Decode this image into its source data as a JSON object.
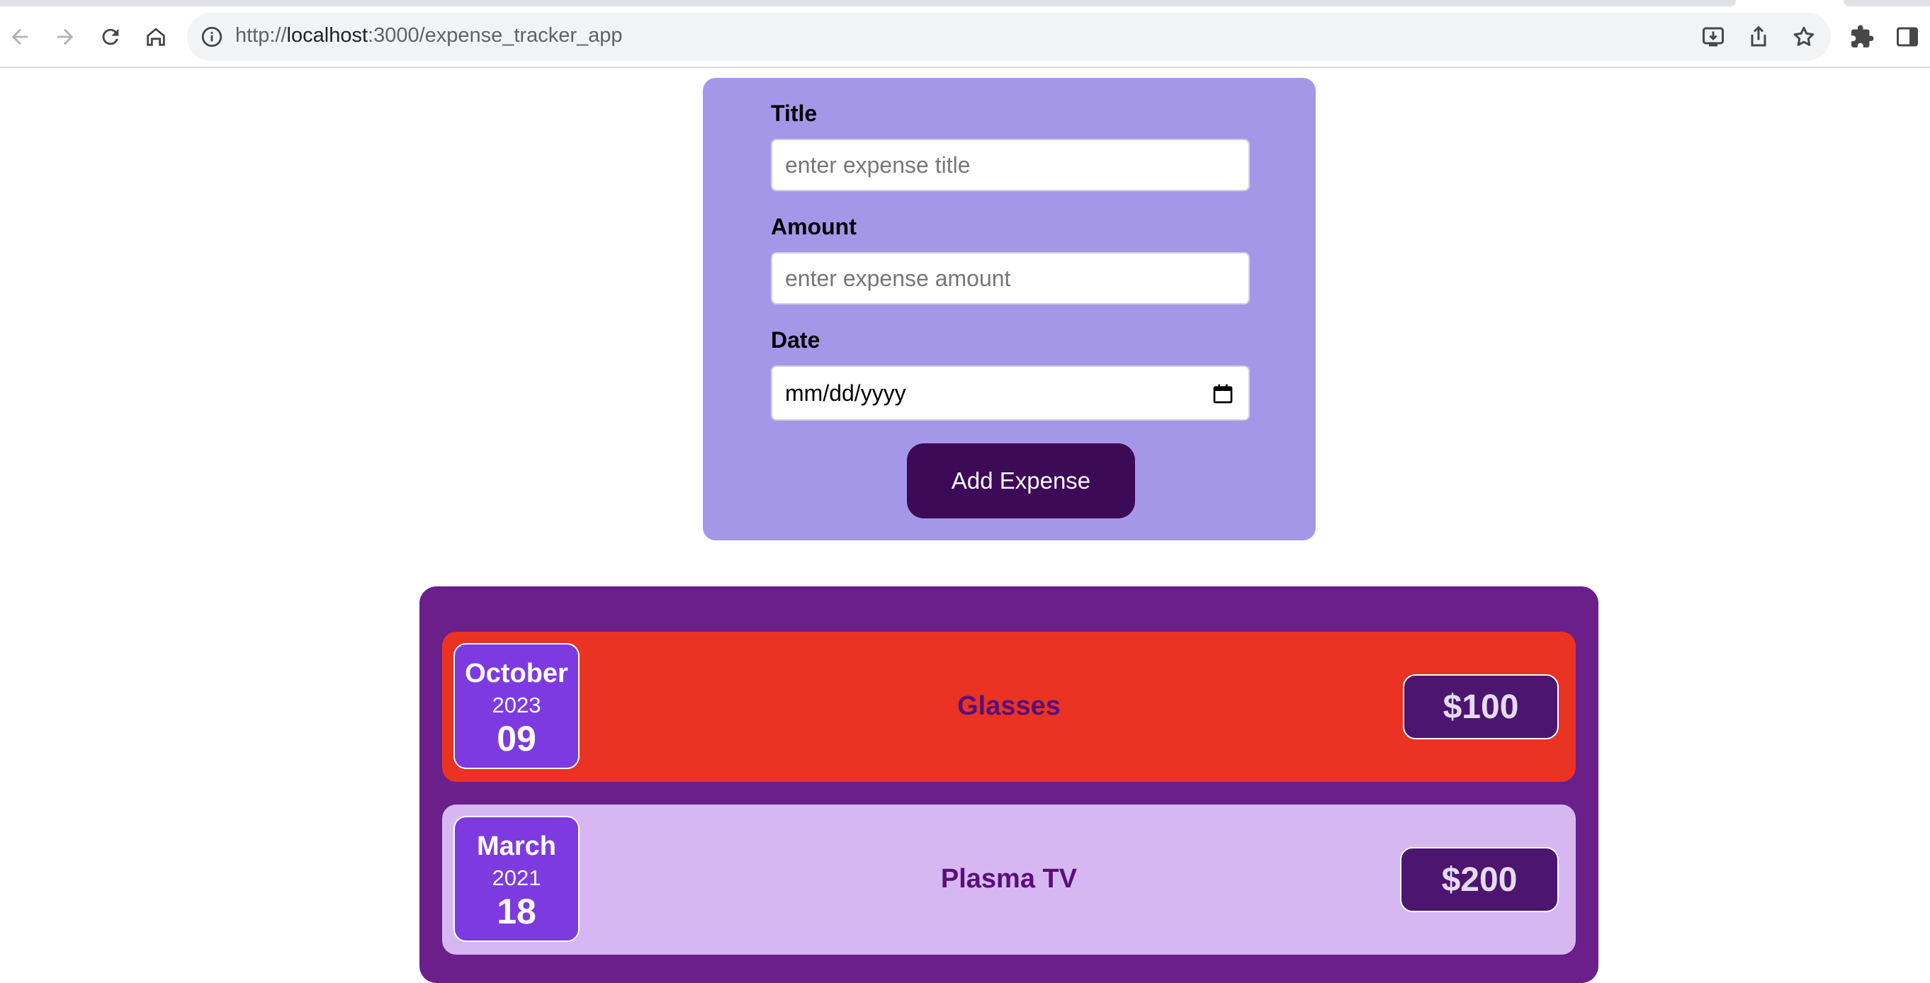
{
  "browser": {
    "url_prefix": "http://",
    "url_host": "localhost",
    "url_rest": ":3000/expense_tracker_app"
  },
  "form": {
    "title_label": "Title",
    "title_placeholder": "enter expense title",
    "amount_label": "Amount",
    "amount_placeholder": "enter expense amount",
    "date_label": "Date",
    "date_value": "mm/dd/yyyy",
    "submit_label": "Add Expense"
  },
  "expenses": [
    {
      "month": "October",
      "year": "2023",
      "day": "09",
      "title": "Glasses",
      "amount": "$100",
      "bg": "#ea3323"
    },
    {
      "month": "March",
      "year": "2021",
      "day": "18",
      "title": "Plasma TV",
      "amount": "$200",
      "bg": "#d6b7f2"
    }
  ],
  "colors": {
    "form_bg": "#a597e8",
    "button_bg": "#3d0a57",
    "list_bg": "#6a1f8a",
    "date_box_bg": "#7d3ae0",
    "price_bg": "#4b1570"
  }
}
